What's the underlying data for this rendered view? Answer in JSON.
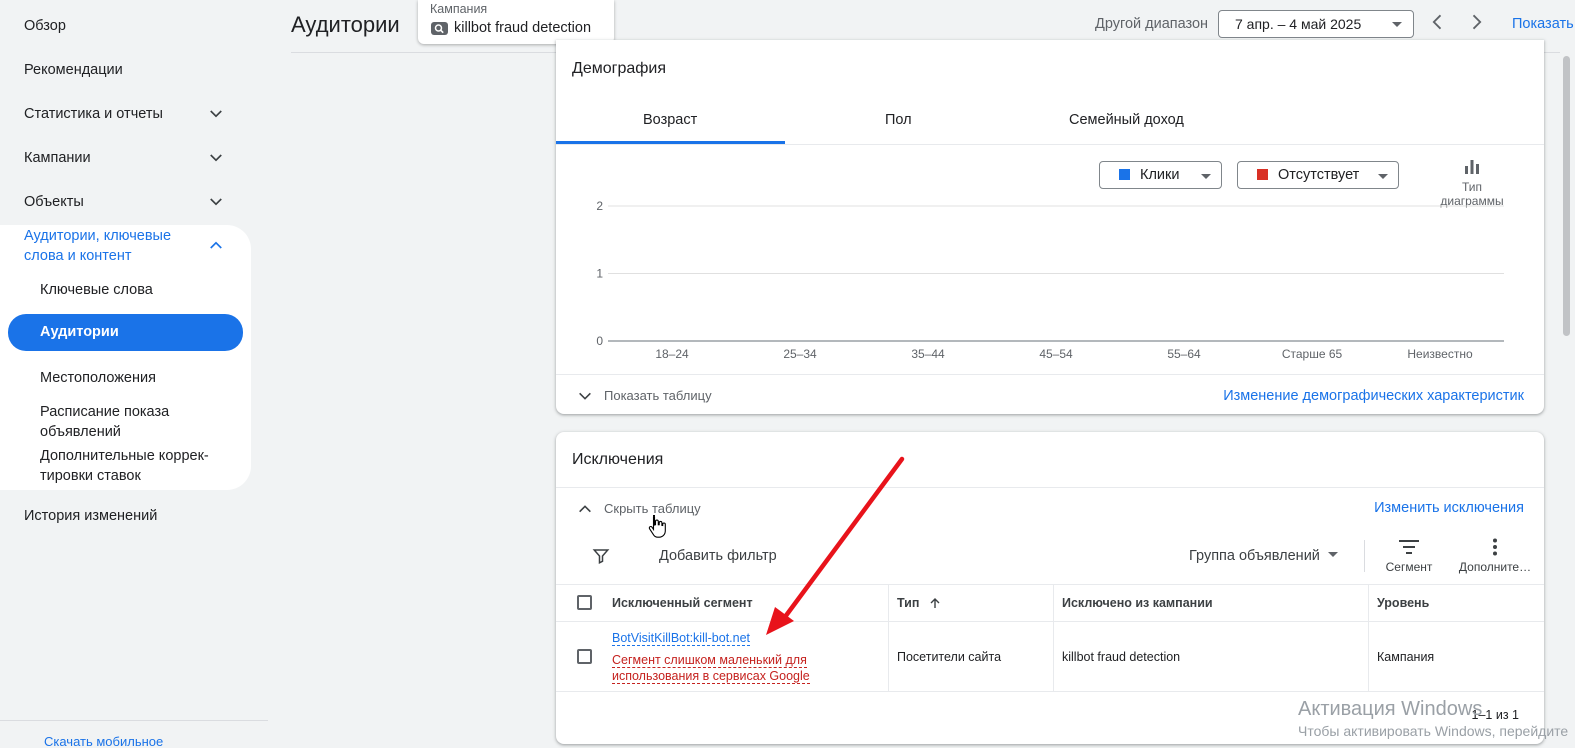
{
  "sidebar": {
    "overview": "Обзор",
    "recommendations": "Рекомендации",
    "stats": "Статистика и отчеты",
    "campaigns": "Кампании",
    "objects": "Объекты",
    "group_title": "Аудитории, ключевые слова и контент",
    "sub_items": [
      "Ключевые слова",
      "Аудитории",
      "Местоположения",
      "Расписание показа объявлений",
      "Дополнительные коррек-тировки ставок"
    ],
    "history": "История изменений",
    "download": "Скачать мобильное"
  },
  "header": {
    "title": "Аудитории",
    "campaign_label": "Кампания",
    "campaign_value": "killbot fraud detection",
    "range_label": "Другой диапазон",
    "range_value": "7 апр. – 4 май 2025",
    "show_link": "Показать"
  },
  "demographics": {
    "title": "Демография",
    "tabs": [
      "Возраст",
      "Пол",
      "Семейный доход"
    ],
    "active_tab": "Возраст",
    "metric1": "Клики",
    "metric1_color": "#1a73e8",
    "metric2": "Отсутствует",
    "metric2_color": "#d93025",
    "chart_type_label": "Тип диаграммы",
    "show_table": "Показать таблицу",
    "edit_link": "Изменение демографических характеристик"
  },
  "chart_data": {
    "type": "bar",
    "categories": [
      "18–24",
      "25–34",
      "35–44",
      "45–54",
      "55–64",
      "Старше 65",
      "Неизвестно"
    ],
    "values": [
      0,
      0,
      0,
      0,
      0,
      0,
      0
    ],
    "yticks": [
      "0",
      "1",
      "2"
    ],
    "ylim": [
      0,
      2
    ],
    "grid": true
  },
  "exclusions": {
    "title": "Исключения",
    "hide_table": "Скрыть таблицу",
    "edit_link": "Изменить исключения",
    "add_filter": "Добавить фильтр",
    "group_select": "Группа объявлений",
    "segment_btn": "Сегмент",
    "more_btn": "Дополните…",
    "columns": [
      "Исключенный сегмент",
      "Тип",
      "Исключено из кампании",
      "Уровень"
    ],
    "rows": [
      {
        "segment": "BotVisitKillBot:kill-bot.net",
        "warning": "Сегмент слишком маленький для использования в сервисах Google",
        "type": "Посетители сайта",
        "campaign": "killbot fraud detection",
        "level": "Кампания"
      }
    ],
    "pager": "1–1 из 1"
  },
  "watermark": {
    "line1": "Активация Windows",
    "line2": "Чтобы активировать Windows, перейдите"
  }
}
